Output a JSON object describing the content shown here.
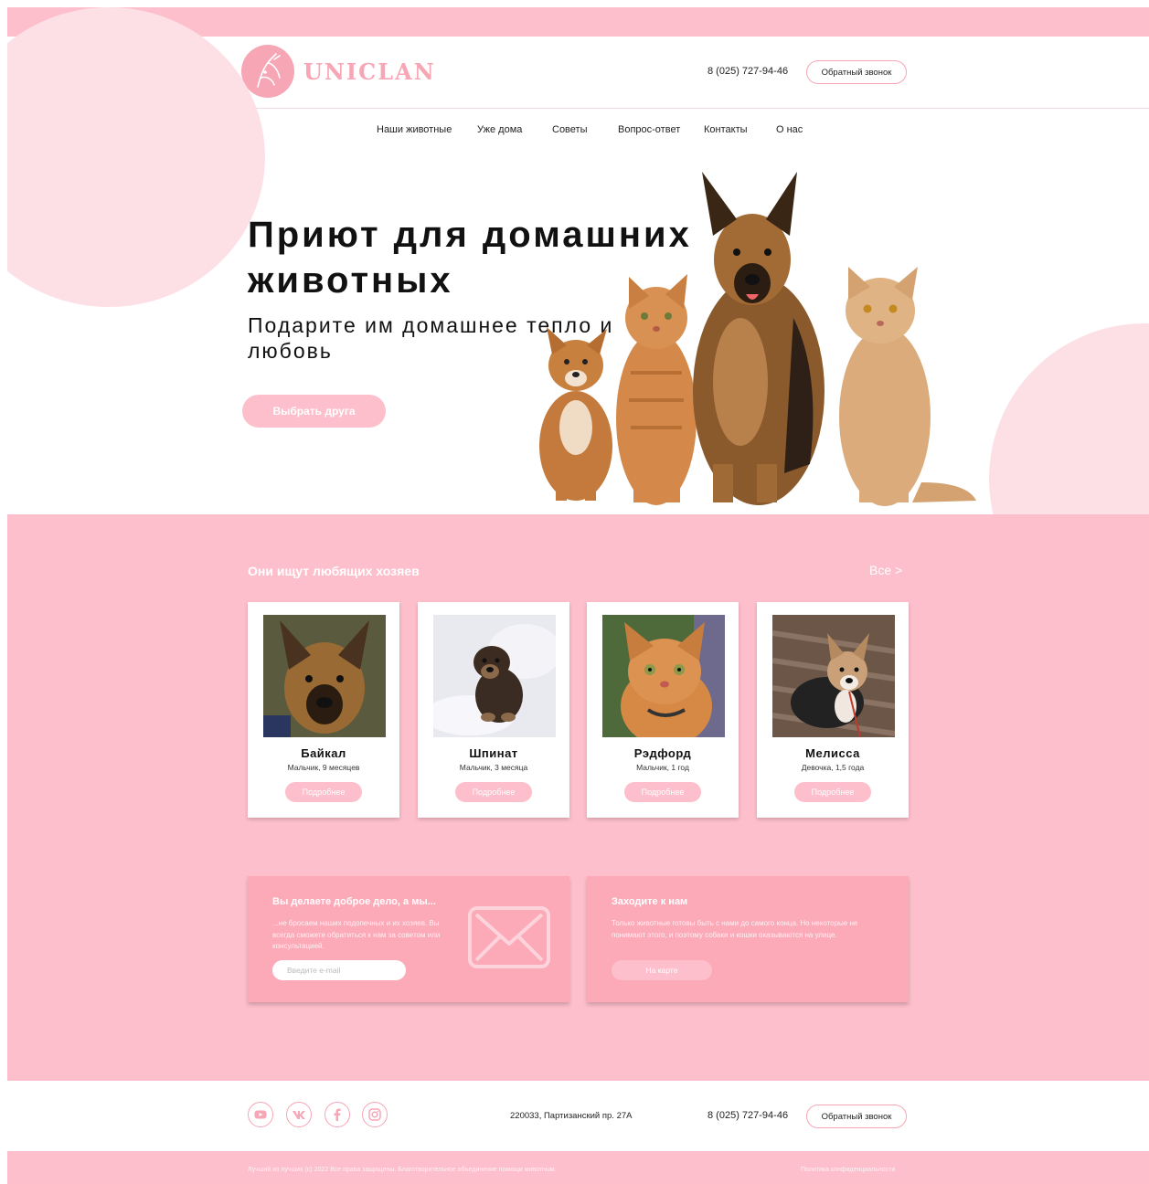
{
  "brand": {
    "name": "UNICLAN",
    "accent": "#f7a6b5",
    "pink_bg": "#fdbfcb"
  },
  "header": {
    "phone": "8 (025) 727-94-46",
    "callback_label": "Обратный звонок"
  },
  "nav": {
    "items": [
      "Наши животные",
      "Уже дома",
      "Советы",
      "Вопрос-ответ",
      "Контакты",
      "О нас"
    ]
  },
  "hero": {
    "title": "Приют для домашних животных",
    "subtitle": "Подарите им домашнее тепло и любовь",
    "cta_label": "Выбрать друга"
  },
  "pets_section": {
    "title": "Они ищут любящих хозяев",
    "all_link": "Все >",
    "pets": [
      {
        "name": "Байкал",
        "desc": "Мальчик, 9 месяцев",
        "button": "Подробнее"
      },
      {
        "name": "Шпинат",
        "desc": "Мальчик, 3 месяца",
        "button": "Подробнее"
      },
      {
        "name": "Рэдфорд",
        "desc": "Мальчик, 1 год",
        "button": "Подробнее"
      },
      {
        "name": "Мелисса",
        "desc": "Девочка, 1,5 года",
        "button": "Подробнее"
      }
    ]
  },
  "newsletter": {
    "title": "Вы делаете доброе дело, а мы...",
    "text": "...не бросаем наших подопечных и их хозяев. Вы всегда сможете обратиться к нам за советом или консультацией.",
    "email_placeholder": "Введите e-mail",
    "icon": "envelope-icon"
  },
  "visit": {
    "title": "Заходите к нам",
    "text": "Только животные готовы быть с нами до самого конца. Но некоторые не понимают этого, и поэтому собаки и кошки оказываются на улице.",
    "button": "На карте"
  },
  "footer": {
    "socials": [
      "youtube-icon",
      "vk-icon",
      "facebook-icon",
      "instagram-icon"
    ],
    "address": "220033, Партизанский пр. 27А",
    "phone": "8 (025) 727-94-46",
    "callback_label": "Обратный звонок",
    "copyright": "Лучший из лучших (с) 2022 Все права защищены. Благотворительное объединение помощи животным.",
    "privacy": "Политика конфиденциальности"
  }
}
